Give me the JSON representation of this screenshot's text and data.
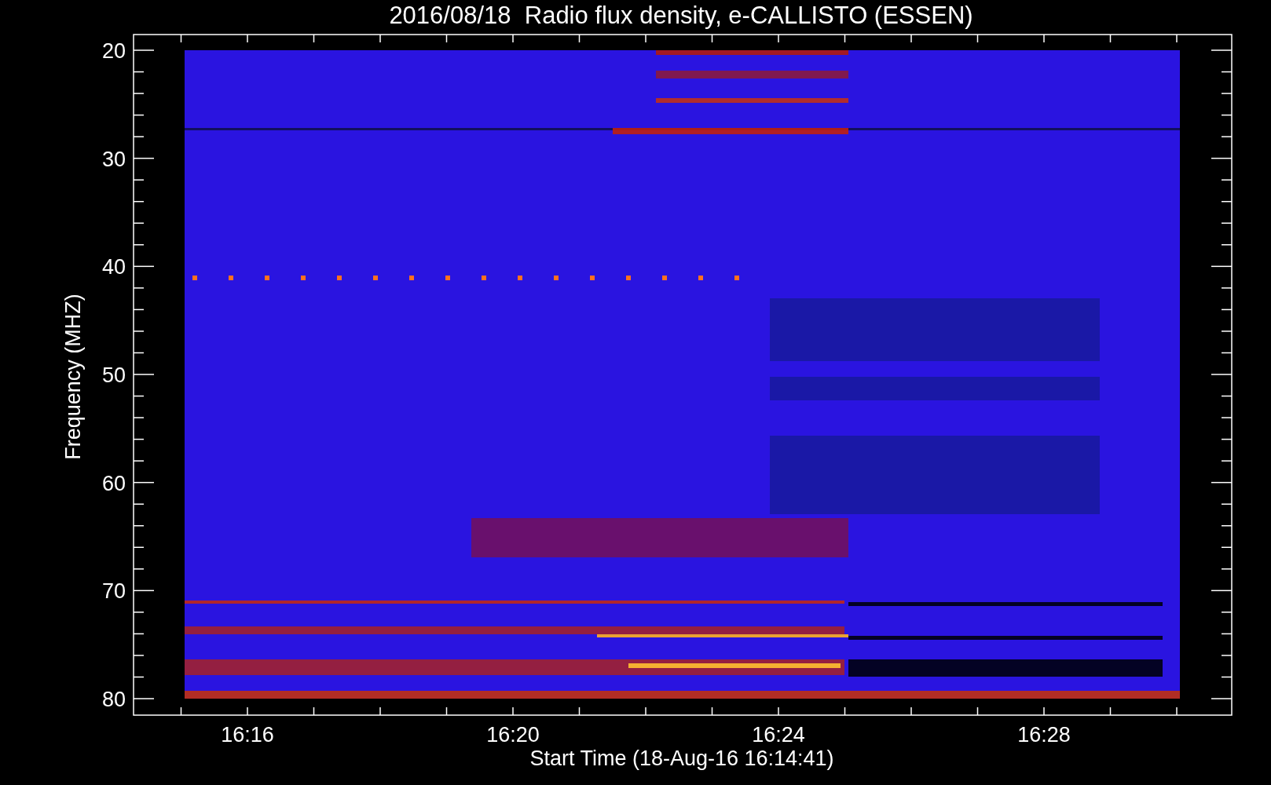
{
  "plot": {
    "title": "2016/08/18  Radio flux density, e-CALLISTO (ESSEN)",
    "y_axis": {
      "label": "Frequency (MHZ)",
      "ticks": [
        "20",
        "30",
        "40",
        "50",
        "60",
        "70",
        "80"
      ]
    },
    "x_axis": {
      "label": "Start Time (18-Aug-16 16:14:41)",
      "ticks": [
        "16:16",
        "16:20",
        "16:24",
        "16:28"
      ]
    }
  }
}
